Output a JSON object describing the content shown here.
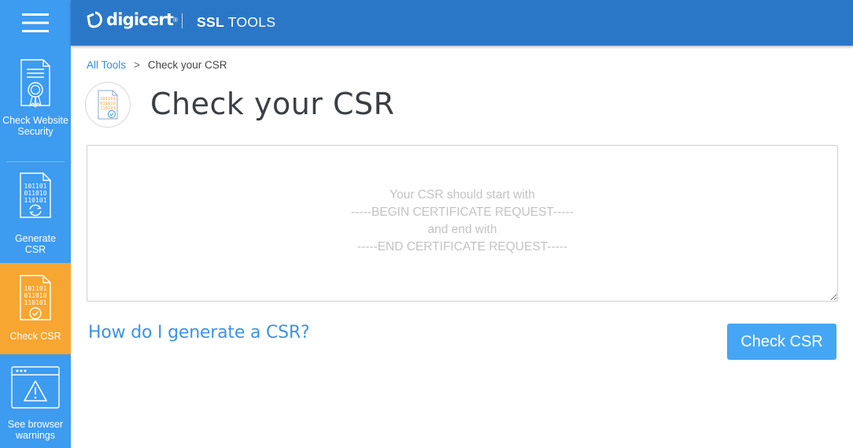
{
  "header": {
    "logo_text": "digicert",
    "logo_mark": "®",
    "product_bold": "SSL",
    "product_rest": "TOOLS"
  },
  "sidebar": {
    "menu_icon": "hamburger-icon",
    "items": [
      {
        "label": "Check Website Security",
        "icon": "certificate-ribbon-icon",
        "active": false
      },
      {
        "label": "Generate CSR",
        "icon": "binary-document-refresh-icon",
        "active": false
      },
      {
        "label": "Check CSR",
        "icon": "binary-document-check-icon",
        "active": true
      },
      {
        "label": "See browser warnings",
        "icon": "browser-warning-icon",
        "active": false
      }
    ]
  },
  "breadcrumb": {
    "root": "All Tools",
    "separator": ">",
    "current": "Check your CSR"
  },
  "main": {
    "title": "Check your CSR",
    "title_icon": "binary-document-check-icon",
    "csr_placeholder": "Your CSR should start with\n-----BEGIN CERTIFICATE REQUEST-----\nand end with\n-----END CERTIFICATE REQUEST-----",
    "csr_value": "",
    "help_link": "How do I generate a CSR?",
    "submit_label": "Check CSR"
  },
  "colors": {
    "sidebar": "#3d9bf0",
    "sidebar_active": "#f7a631",
    "topbar": "#2b77c7",
    "link": "#2f8de4",
    "button": "#45a6f5"
  }
}
